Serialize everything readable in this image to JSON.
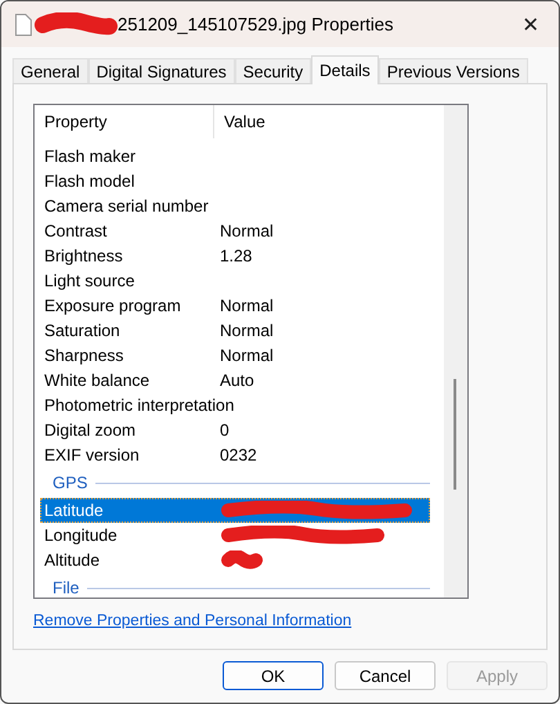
{
  "window": {
    "title": "251209_145107529.jpg Properties",
    "close": "✕"
  },
  "tabs": [
    {
      "label": "General",
      "selected": false
    },
    {
      "label": "Digital Signatures",
      "selected": false
    },
    {
      "label": "Security",
      "selected": false
    },
    {
      "label": "Details",
      "selected": true
    },
    {
      "label": "Previous Versions",
      "selected": false
    }
  ],
  "table": {
    "columns": [
      "Property",
      "Value"
    ],
    "rows": [
      {
        "kind": "property",
        "name": "Flash maker",
        "value": "",
        "selected": false
      },
      {
        "kind": "property",
        "name": "Flash model",
        "selected": false
      },
      {
        "kind": "property",
        "name": "Camera serial number",
        "selected": false
      },
      {
        "kind": "property",
        "name": "Contrast",
        "value": "Normal",
        "selected": false
      },
      {
        "kind": "property",
        "name": "Brightness",
        "value": "1.28",
        "selected": false
      },
      {
        "kind": "property",
        "name": "Light source",
        "selected": false
      },
      {
        "kind": "property",
        "name": "Exposure program",
        "value": "Normal",
        "selected": false
      },
      {
        "kind": "property",
        "name": "Saturation",
        "value": "Normal",
        "selected": false
      },
      {
        "kind": "property",
        "name": "Sharpness",
        "value": "Normal",
        "selected": false
      },
      {
        "kind": "property",
        "name": "White balance",
        "value": "Auto",
        "selected": false
      },
      {
        "kind": "property",
        "name": "Photometric interpretation",
        "selected": false
      },
      {
        "kind": "property",
        "name": "Digital zoom",
        "value": "0",
        "selected": false
      },
      {
        "kind": "property",
        "name": "EXIF version",
        "value": "0232",
        "selected": false
      },
      {
        "kind": "group",
        "name": "GPS"
      },
      {
        "kind": "property",
        "name": "Latitude",
        "redacted": true,
        "selected": true
      },
      {
        "kind": "property",
        "name": "Longitude",
        "redacted": true,
        "selected": false
      },
      {
        "kind": "property",
        "name": "Altitude",
        "redacted": true,
        "selected": false
      },
      {
        "kind": "group",
        "name": "File"
      }
    ]
  },
  "link": "Remove Properties and Personal Information",
  "buttons": [
    {
      "label": "OK",
      "disabled": false,
      "default": true
    },
    {
      "label": "Cancel",
      "disabled": false,
      "default": false
    },
    {
      "label": "Apply",
      "disabled": true,
      "default": false
    }
  ]
}
